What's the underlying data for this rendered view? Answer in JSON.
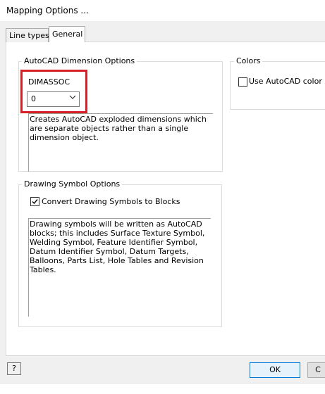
{
  "window": {
    "title": "Mapping Options ..."
  },
  "tabs": [
    {
      "label": "Line types",
      "active": false
    },
    {
      "label": "General",
      "active": true
    }
  ],
  "autocad_dimension": {
    "title": "AutoCAD Dimension Options",
    "dimassoc_label": "DIMASSOC",
    "dimassoc_value": "0",
    "description": "Creates AutoCAD exploded dimensions which are separate objects rather than a single dimension object.",
    "highlight_color": "#d61f26"
  },
  "colors": {
    "title": "Colors",
    "use_autocad_color_label": "Use AutoCAD color ind",
    "use_autocad_color_checked": false
  },
  "drawing_symbol": {
    "title": "Drawing Symbol Options",
    "convert_label": "Convert Drawing Symbols to Blocks",
    "convert_checked": true,
    "description": "Drawing symbols will be written as AutoCAD blocks; this includes Surface Texture Symbol, Welding Symbol, Feature Identifier Symbol, Datum Identifier Symbol, Datum Targets, Balloons, Parts List, Hole Tables and Revision Tables."
  },
  "footer": {
    "help_glyph": "?",
    "ok_label": "OK",
    "cancel_label": "C"
  }
}
